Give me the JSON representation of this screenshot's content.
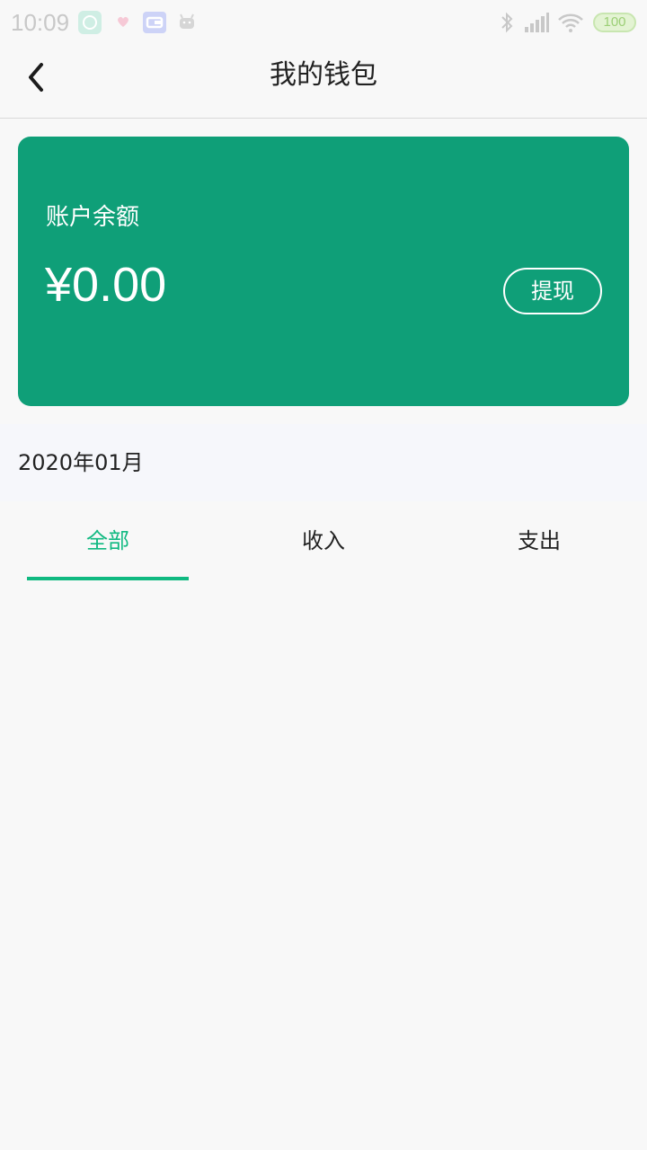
{
  "status_bar": {
    "time": "10:09",
    "battery": "100",
    "icons": [
      "compass-app-icon",
      "heart-app-icon",
      "card-app-icon",
      "android-app-icon",
      "bluetooth-icon",
      "signal-icon",
      "wifi-icon",
      "battery-icon"
    ]
  },
  "nav": {
    "title": "我的钱包",
    "back_icon": "chevron-left-icon"
  },
  "balance": {
    "label": "账户余额",
    "amount": "¥0.00",
    "withdraw_label": "提现"
  },
  "month": "2020年01月",
  "tabs": [
    {
      "label": "全部",
      "active": true
    },
    {
      "label": "收入",
      "active": false
    },
    {
      "label": "支出",
      "active": false
    }
  ],
  "colors": {
    "accent": "#10b981",
    "card": "#0f9f78",
    "background": "#f8f8f8"
  }
}
